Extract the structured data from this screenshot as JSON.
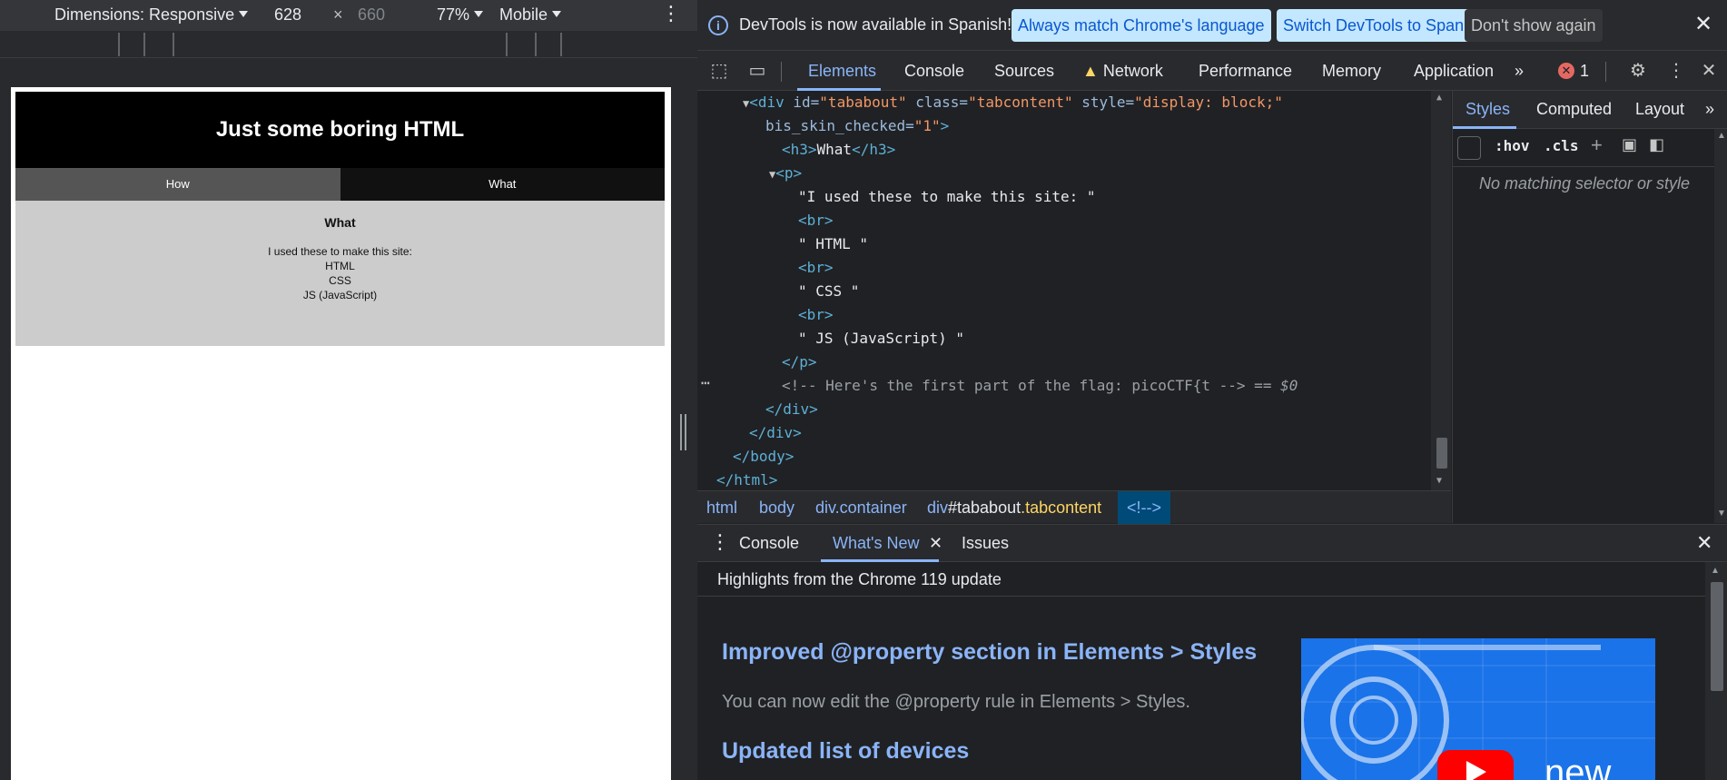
{
  "device_toolbar": {
    "dimensions_label": "Dimensions: Responsive",
    "width": "628",
    "times": "×",
    "height": "660",
    "zoom": "77%",
    "throttle": "Mobile"
  },
  "site": {
    "header_title": "Just some boring HTML",
    "tabs": [
      "How",
      "What"
    ],
    "content_heading": "What",
    "content_lines": [
      "I used these to make this site:",
      "HTML",
      "CSS",
      "JS (JavaScript)"
    ]
  },
  "infobar": {
    "message": "DevTools is now available in Spanish!",
    "btn_match": "Always match Chrome's language",
    "btn_switch": "Switch DevTools to Spanish",
    "btn_dismiss": "Don't show again"
  },
  "main_tabs": [
    "Elements",
    "Console",
    "Sources",
    "Network",
    "Performance",
    "Memory",
    "Application"
  ],
  "error_count": "1",
  "dom": {
    "l1_tag": "<div",
    "l1_id_attr": " id=",
    "l1_id_val": "\"tababout\"",
    "l1_class_attr": " class=",
    "l1_class_val": "\"tabcontent\"",
    "l1_style_attr": " style=",
    "l1_style_val": "\"display: block;\"",
    "l2_attr": "bis_skin_checked=",
    "l2_val": "\"1\"",
    "l2_close": ">",
    "h3_open": "<h3>",
    "h3_text": "What",
    "h3_close": "</h3>",
    "p_open": "<p>",
    "t1": "\"I used these to make this site: \"",
    "br": "<br>",
    "t2": "\" HTML \"",
    "t3": "\" CSS \"",
    "t4": "\" JS (JavaScript) \"",
    "p_close": "</p>",
    "comment": "<!-- Here's the first part of the flag: picoCTF{t -->",
    "eq": " == ",
    "dollar": "$0",
    "div_close": "</div>",
    "body_close": "</body>",
    "html_close": "</html>"
  },
  "breadcrumbs": {
    "html": "html",
    "body": "body",
    "container": "div.container",
    "div_tag": "div",
    "div_id": "#tababout",
    "div_class": ".tabcontent",
    "comment": "<!-->"
  },
  "styles": {
    "tabs": [
      "Styles",
      "Computed",
      "Layout"
    ],
    "hov": ":hov",
    "cls": ".cls",
    "no_match": "No matching selector or style"
  },
  "drawer": {
    "tabs": [
      "Console",
      "What's New",
      "Issues"
    ],
    "highlights": "Highlights from the Chrome 119 update",
    "heading1": "Improved @property section in Elements > Styles",
    "para1": "You can now edit the @property rule in Elements > Styles.",
    "heading2": "Updated list of devices",
    "promo_text": "new"
  }
}
